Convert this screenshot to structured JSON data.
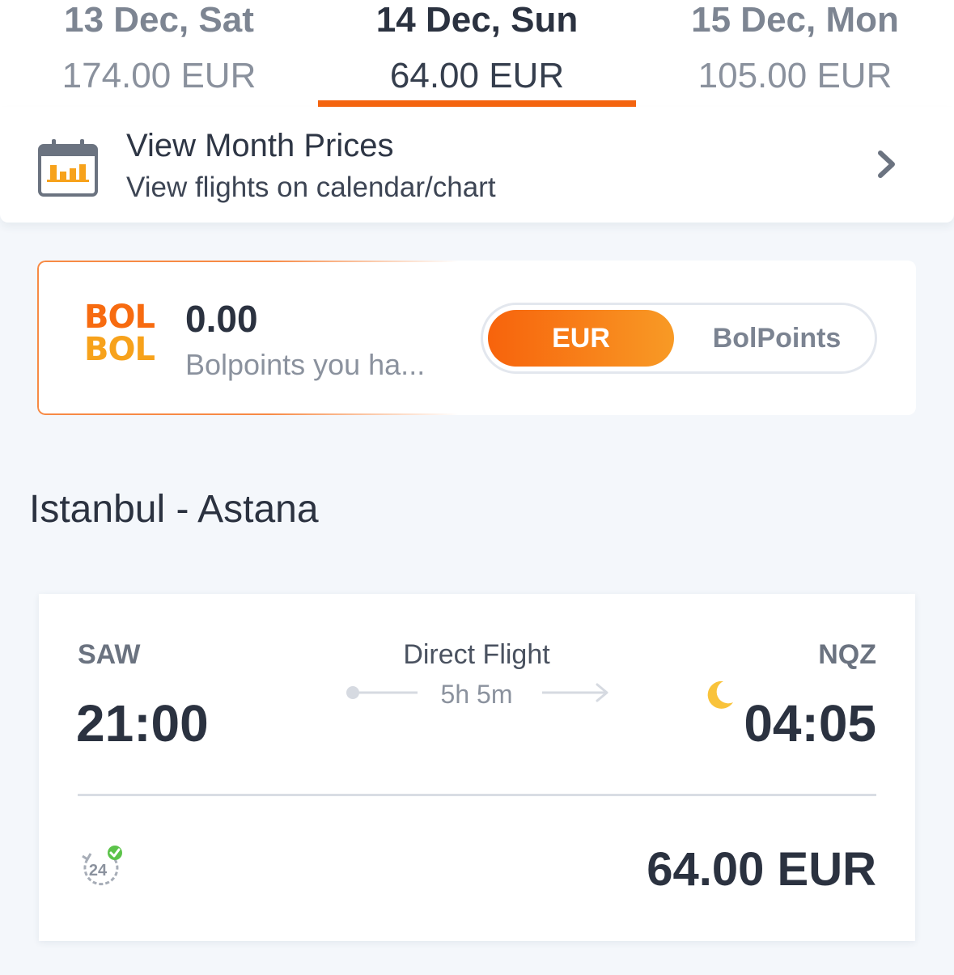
{
  "date_tabs": [
    {
      "day": "13 Dec, Sat",
      "price": "174.00 EUR"
    },
    {
      "day": "14 Dec, Sun",
      "price": "64.00 EUR"
    },
    {
      "day": "15 Dec, Mon",
      "price": "105.00 EUR"
    }
  ],
  "active_tab_index": 1,
  "month_prices": {
    "title": "View Month Prices",
    "subtitle": "View flights on calendar/chart",
    "icon": "calendar-chart-icon",
    "chevron": "chevron-right-icon"
  },
  "bolpoints": {
    "logo_top": "BOL",
    "logo_bottom": "BOL",
    "amount": "0.00",
    "note": "Bolpoints you ha...",
    "toggle": {
      "option_a": "EUR",
      "option_b": "BolPoints",
      "selected": "EUR"
    }
  },
  "route": {
    "title": "Istanbul - Astana"
  },
  "flight": {
    "from_code": "SAW",
    "to_code": "NQZ",
    "departure": "21:00",
    "arrival": "04:05",
    "type": "Direct Flight",
    "duration": "5h 5m",
    "night_icon": "moon-icon",
    "cancel_icon_text": "24",
    "price": "64.00 EUR"
  },
  "colors": {
    "accent": "#f4640f",
    "accent_light": "#f89a25",
    "moon": "#f9c33b",
    "check": "#5cc34a"
  }
}
